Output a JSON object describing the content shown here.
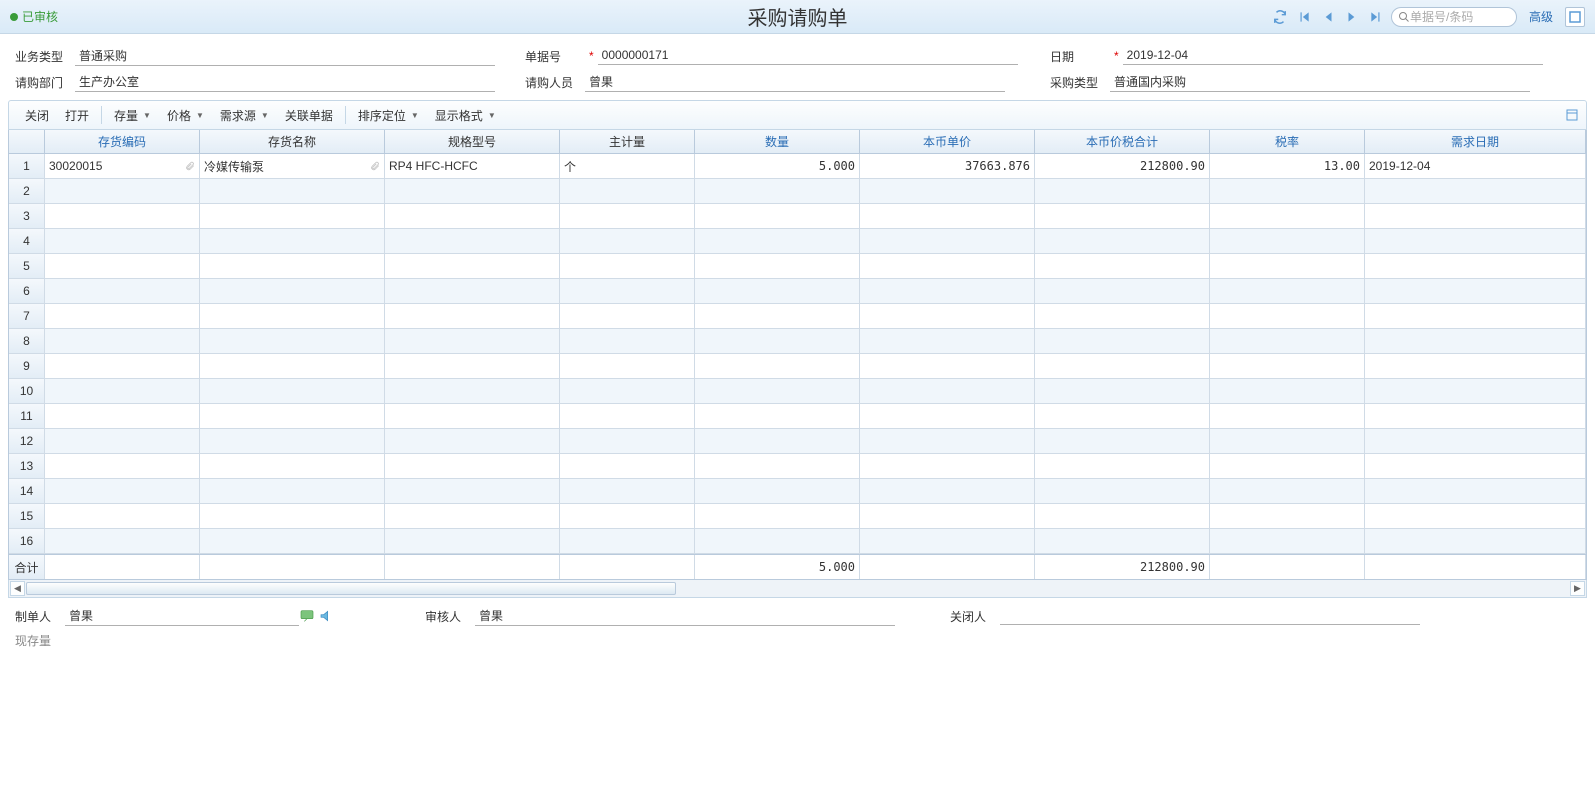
{
  "header": {
    "status_text": "已审核",
    "title": "采购请购单",
    "search_placeholder": "单据号/条码",
    "advanced": "高级"
  },
  "form": {
    "biz_type_label": "业务类型",
    "biz_type_value": "普通采购",
    "doc_no_label": "单据号",
    "doc_no_value": "0000000171",
    "date_label": "日期",
    "date_value": "2019-12-04",
    "dept_label": "请购部门",
    "dept_value": "生产办公室",
    "person_label": "请购人员",
    "person_value": "曾果",
    "pur_type_label": "采购类型",
    "pur_type_value": "普通国内采购"
  },
  "toolbar": {
    "close": "关闭",
    "open": "打开",
    "stock": "存量",
    "price": "价格",
    "demand": "需求源",
    "related": "关联单据",
    "sort": "排序定位",
    "display": "显示格式"
  },
  "grid": {
    "headers": {
      "code": "存货编码",
      "name": "存货名称",
      "spec": "规格型号",
      "unit": "主计量",
      "qty": "数量",
      "price": "本币单价",
      "total": "本币价税合计",
      "tax": "税率",
      "date": "需求日期"
    },
    "rows": [
      {
        "code": "30020015",
        "name": "冷媒传输泵",
        "spec": "RP4 HFC-HCFC",
        "unit": "个",
        "qty": "5.000",
        "price": "37663.876",
        "total": "212800.90",
        "tax": "13.00",
        "date": "2019-12-04"
      }
    ],
    "totals_label": "合计",
    "totals": {
      "qty": "5.000",
      "total": "212800.90"
    },
    "row_count": 16
  },
  "footer": {
    "creator_label": "制单人",
    "creator_value": "曾果",
    "auditor_label": "审核人",
    "auditor_value": "曾果",
    "closer_label": "关闭人",
    "closer_value": "",
    "current_stock_label": "现存量"
  }
}
